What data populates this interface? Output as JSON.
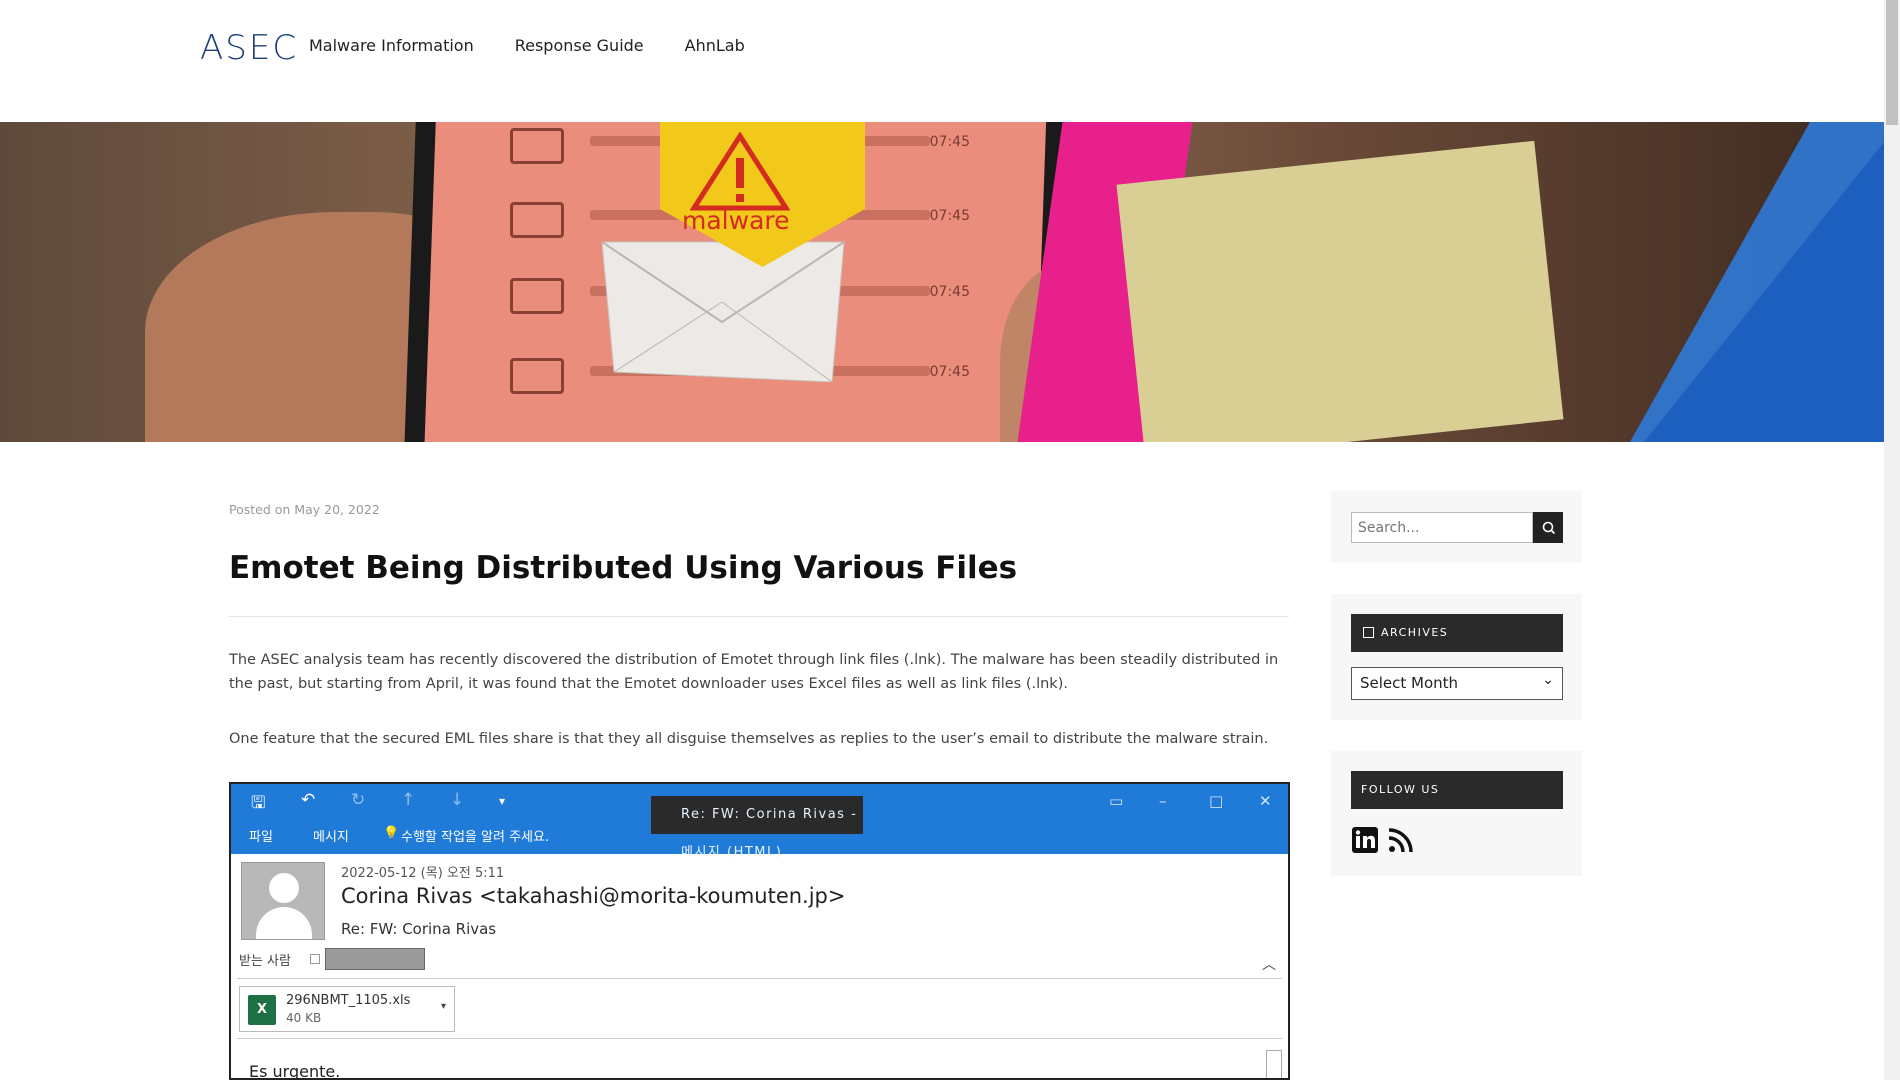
{
  "header": {
    "logo": "ASEC",
    "nav": [
      "Malware Information",
      "Response Guide",
      "AhnLab"
    ]
  },
  "hero": {
    "malware_label": "malware",
    "time_labels": [
      "07:45",
      "07:45",
      "07:45",
      "07:45"
    ]
  },
  "article": {
    "posted": "Posted on May 20, 2022",
    "title": "Emotet Being Distributed Using Various Files",
    "paragraph1": "The ASEC analysis team has recently discovered the distribution of Emotet through link files (.lnk). The malware has been steadily distributed in the past, but starting from April, it was found that the Emotet downloader uses Excel files as well as link files (.lnk).",
    "paragraph2": "One feature that the secured EML files share is that they all disguise themselves as replies to the user’s email to distribute the malware strain."
  },
  "email": {
    "window_title": "Re: FW: Corina Rivas - 메시지 (HTML)",
    "menu": [
      "파일",
      "메시지",
      "수행할 작업을 알려 주세요."
    ],
    "date": "2022-05-12 (목) 오전 5:11",
    "from": "Corina Rivas <takahashi@morita-koumuten.jp>",
    "subject": "Re: FW: Corina Rivas",
    "to_label": "받는 사람",
    "attachment_name": "296NBMT_1105.xls",
    "attachment_size": "40 KB",
    "body_start": "Es urgente."
  },
  "sidebar": {
    "search_placeholder": "Search...",
    "archives_title": "ARCHIVES",
    "archives_select": "Select Month",
    "follow_title": "FOLLOW US",
    "social": [
      "linkedin-icon",
      "rss-icon"
    ]
  }
}
